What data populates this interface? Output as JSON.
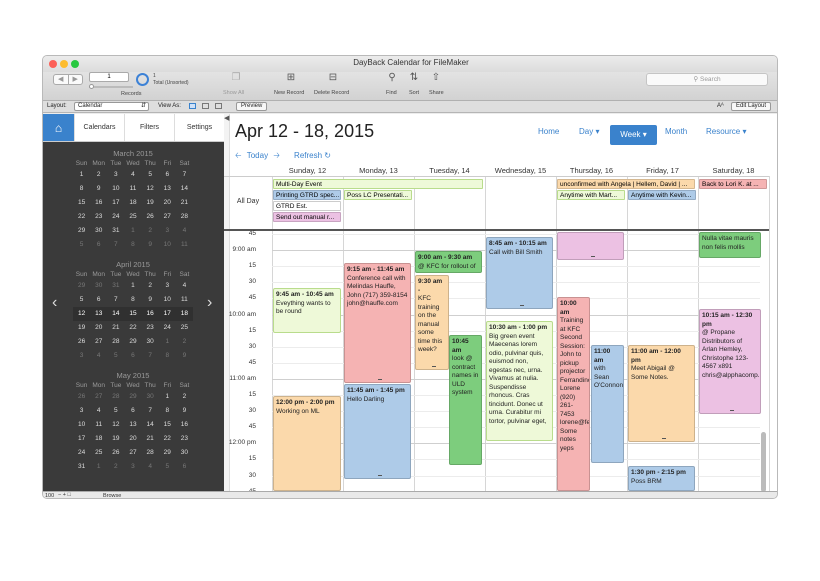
{
  "window": {
    "title": "DayBack Calendar for FileMaker"
  },
  "toolbar": {
    "record_number": "1",
    "records_total": "1",
    "records_sorted": "Total (Unsorted)",
    "records_label": "Records",
    "show_all": "Show All",
    "new_record": "New Record",
    "delete_record": "Delete Record",
    "find": "Find",
    "sort": "Sort",
    "share": "Share",
    "search_placeholder": "Search"
  },
  "layoutbar": {
    "layout_label": "Layout:",
    "layout_value": "Calendar",
    "view_as": "View As:",
    "preview": "Preview",
    "font_size_icon": "Aᴬ",
    "edit_layout": "Edit Layout"
  },
  "sidebar": {
    "tabs": [
      "Calendars",
      "Filters",
      "Settings"
    ],
    "dow": [
      "Sun",
      "Mon",
      "Tue",
      "Wed",
      "Thu",
      "Fri",
      "Sat"
    ],
    "months": [
      {
        "name": "March 2015",
        "days": [
          "1",
          "2",
          "3",
          "4",
          "5",
          "6",
          "7",
          "8",
          "9",
          "10",
          "11",
          "12",
          "13",
          "14",
          "15",
          "16",
          "17",
          "18",
          "19",
          "20",
          "21",
          "22",
          "23",
          "24",
          "25",
          "26",
          "27",
          "28",
          "29",
          "30",
          "31",
          "1",
          "2",
          "3",
          "4",
          "5",
          "6",
          "7",
          "8",
          "9",
          "10",
          "11"
        ]
      },
      {
        "name": "April 2015",
        "days": [
          "29",
          "30",
          "31",
          "1",
          "2",
          "3",
          "4",
          "5",
          "6",
          "7",
          "8",
          "9",
          "10",
          "11",
          "12",
          "13",
          "14",
          "15",
          "16",
          "17",
          "18",
          "19",
          "20",
          "21",
          "22",
          "23",
          "24",
          "25",
          "26",
          "27",
          "28",
          "29",
          "30",
          "1",
          "2",
          "3",
          "4",
          "5",
          "6",
          "7",
          "8",
          "9"
        ]
      },
      {
        "name": "May 2015",
        "days": [
          "26",
          "27",
          "28",
          "29",
          "30",
          "1",
          "2",
          "3",
          "4",
          "5",
          "6",
          "7",
          "8",
          "9",
          "10",
          "11",
          "12",
          "13",
          "14",
          "15",
          "16",
          "17",
          "18",
          "19",
          "20",
          "21",
          "22",
          "23",
          "24",
          "25",
          "26",
          "27",
          "28",
          "29",
          "30",
          "31",
          "1",
          "2",
          "3",
          "4",
          "5",
          "6"
        ]
      }
    ]
  },
  "calendar": {
    "title": "Apr 12 - 18, 2015",
    "today": "Today",
    "refresh": "Refresh",
    "nav": {
      "home": "Home",
      "day": "Day",
      "week": "Week",
      "month": "Month",
      "resource": "Resource"
    },
    "days": [
      "Sunday, 12",
      "Monday, 13",
      "Tuesday, 14",
      "Wednesday, 15",
      "Thursday, 16",
      "Friday, 17",
      "Saturday, 18"
    ],
    "all_day_label": "All Day",
    "time_labels": [
      "45",
      "9:00 am",
      "15",
      "30",
      "45",
      "10:00 am",
      "15",
      "30",
      "45",
      "11:00 am",
      "15",
      "30",
      "45",
      "12:00 pm",
      "15",
      "30",
      "45",
      "1:00 pm",
      "15",
      "30"
    ],
    "all_day_events": [
      "Multi-Day Event",
      "Printing GTRD spec...",
      "GTRD Est.",
      "Send out manual r...",
      "Poss LC Presentati...",
      "unconfirmed with Angela | Hellem, David | ...",
      "Anytime with Mart...",
      "Anytime with Kevin...",
      "Back to Lori K. at ..."
    ],
    "events": [
      {
        "time": "9:45 am - 10:45 am",
        "text": "Eveything wants to be round"
      },
      {
        "time": "12:00 pm - 2:00 pm",
        "text": "Working on ML"
      },
      {
        "time": "9:15 am - 11:45 am",
        "text": "Conference call with Melindas Hauffe, John (717) 359-8154 john@hauffe.com"
      },
      {
        "time": "11:45 am - 1:45 pm",
        "text": "Hello Darling"
      },
      {
        "time": "9:00 am - 9:30 am",
        "text": "@ KFC for rollout of"
      },
      {
        "time": "9:30 am -",
        "text": "KFC training on the manual some time this week?"
      },
      {
        "time": "10:45 am",
        "text": "look @ contract names in ULD system"
      },
      {
        "time": "8:45 am - 10:15 am",
        "text": "Call with Bill Smith"
      },
      {
        "time": "10:30 am - 1:00 pm",
        "text": "Big green event Maecenas lorem odio, pulvinar quis, euismod non, egestas nec, urna. Vivamus at nulia. Suspendisse rhoncus. Cras tincidunt. Donec ut urna. Curabitur mi tortor, pulvinar eget,"
      },
      {
        "time": "10:00 am",
        "text": "Training at KFC Second Session: John to pickup projector Ferrandino, Lorene (920) 261-7453 lorene@fer Some notes yeps"
      },
      {
        "time": "11:00 am",
        "text": "with Sean O'Connon"
      },
      {
        "time": "11:00 am - 12:00 pm",
        "text": "Meet Abigail @ Some Notes."
      },
      {
        "time": "1:30 pm - 2:15 pm",
        "text": "Poss BRM"
      },
      {
        "time": "",
        "text": "Nulla vitae mauris non felis mollis"
      },
      {
        "time": "10:15 am - 12:30 pm",
        "text": "@ Propane Distributors of Arlan Hemley, Christophe 123-4567 x891 chris@alpphacomp."
      }
    ]
  },
  "bottombar": {
    "zoom": "100",
    "mode": "Browse"
  },
  "colors": {
    "accent": "#3a82cc",
    "sidebar": "#3a3a3a"
  }
}
